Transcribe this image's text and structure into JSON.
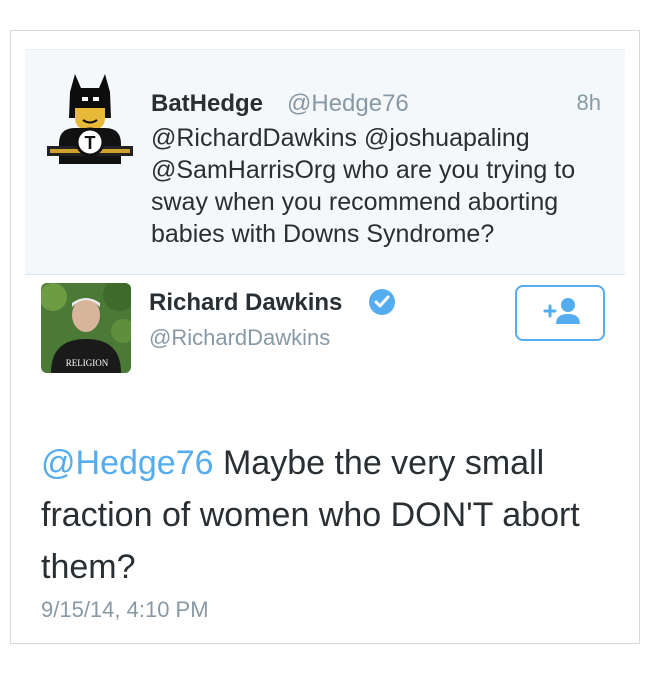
{
  "reply_tweet": {
    "name": "BatHedge",
    "handle": "@Hedge76",
    "time": "8h",
    "text": "@RichardDawkins @joshuapaling @SamHarrisOrg who are you trying to sway when you recommend aborting babies with Downs Syndrome?",
    "avatar_icon": "batman-lego-avatar-icon"
  },
  "main_tweet": {
    "name": "Richard Dawkins",
    "handle": "@RichardDawkins",
    "verified_icon": "verified-badge-icon",
    "follow_icon": "follow-plus-user-icon",
    "mention": "@Hedge76",
    "text_rest": " Maybe the very small fraction of women who DON'T abort them?",
    "date": "9/15/14, 4:10 PM",
    "avatar_shirt_text": "RELIGION"
  },
  "colors": {
    "link": "#55acee",
    "muted": "#8899a6",
    "text": "#292f33"
  }
}
